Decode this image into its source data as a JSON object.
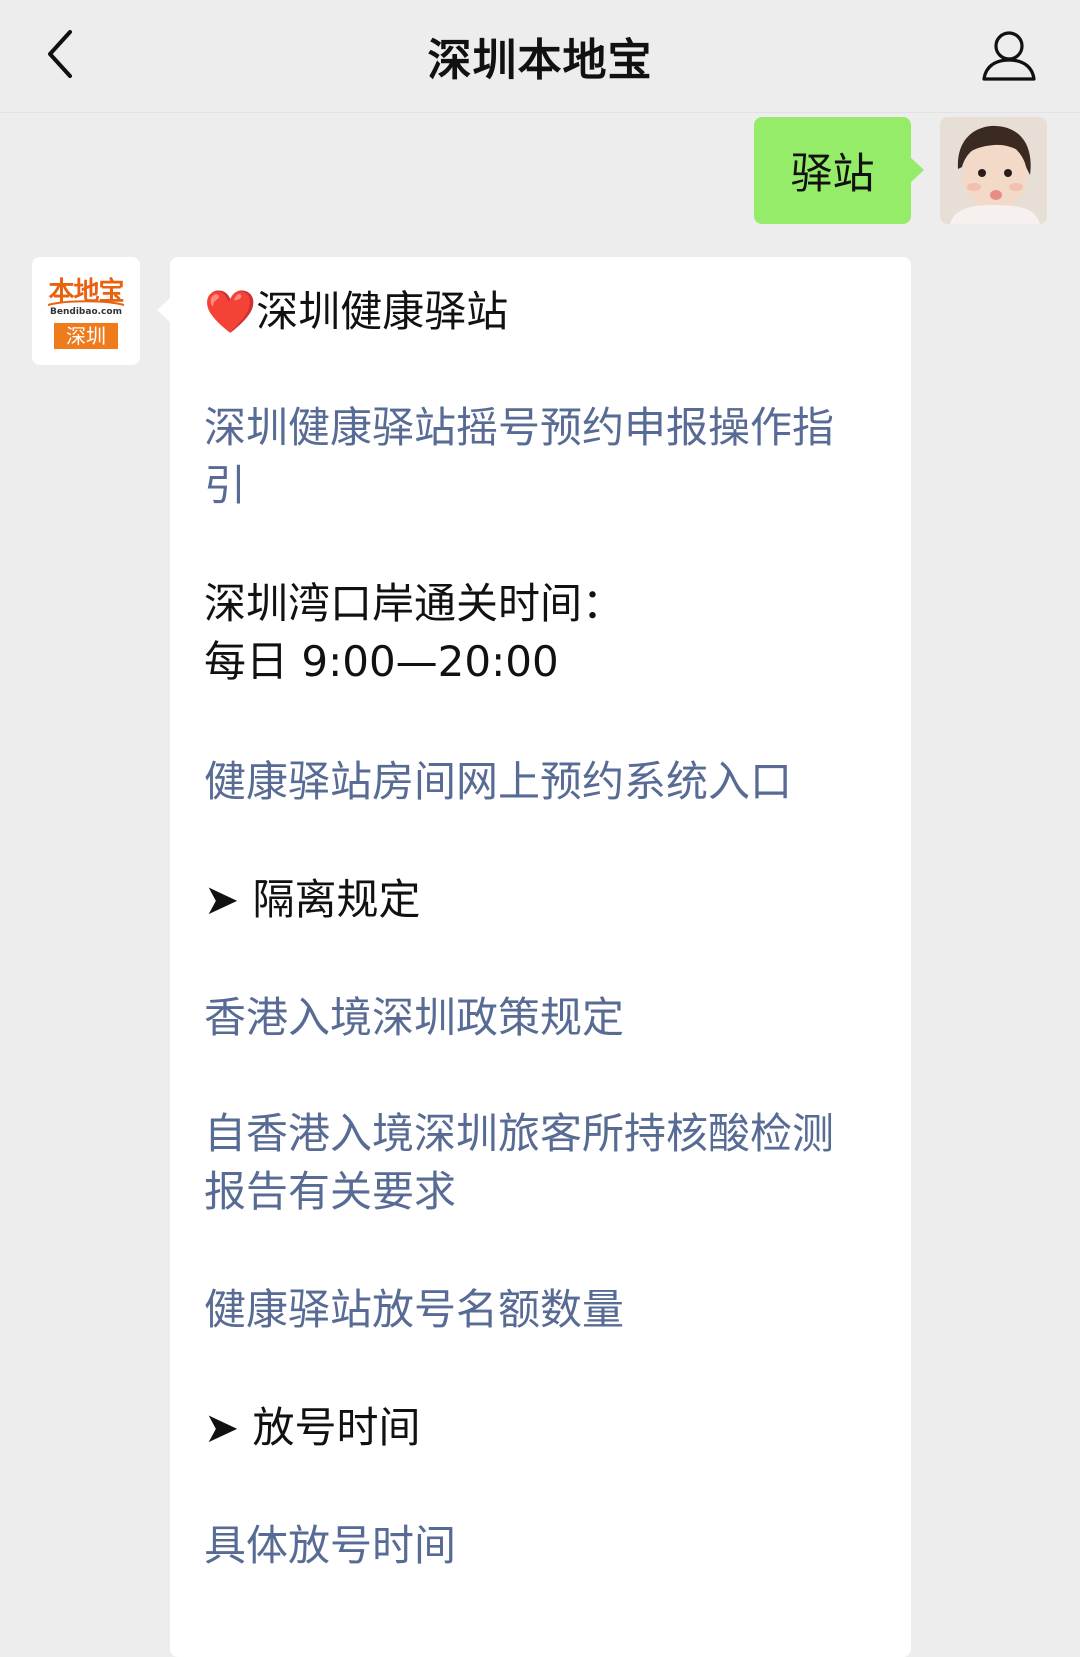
{
  "header": {
    "title": "深圳本地宝",
    "back_icon": "chevron-left-icon",
    "profile_icon": "person-icon"
  },
  "user_message": {
    "text": "驿站",
    "bubble_color": "#95ec69"
  },
  "bot_avatar": {
    "top_text": "本地宝",
    "domain_text": "Bendibao.com",
    "box_text": "深圳",
    "brand_color": "#f07b1d"
  },
  "bot_message": {
    "heart_icon": "❤️",
    "title": "深圳健康驿站",
    "link_color": "#576b95",
    "items": [
      "深圳健康驿站摇号预约申报操作指引",
      "深圳湾口岸通关时间：",
      "每日 9:00—20:00",
      "健康驿站房间网上预约系统入口",
      "➤ 隔离规定",
      "香港入境深圳政策规定",
      "自香港入境深圳旅客所持核酸检测报告有关要求",
      "健康驿站放号名额数量",
      "➤ 放号时间",
      "具体放号时间"
    ]
  }
}
